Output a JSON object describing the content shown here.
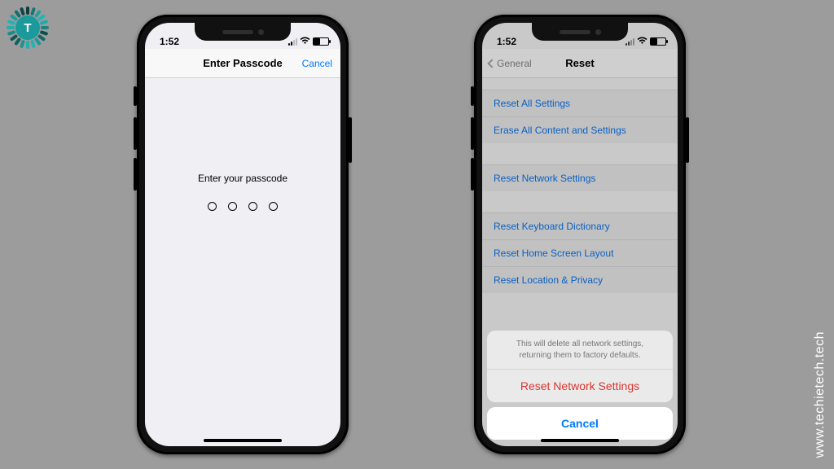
{
  "site": {
    "logo_letter": "T",
    "watermark": "www.techietech.tech"
  },
  "status": {
    "time": "1:52"
  },
  "phone1": {
    "nav_title": "Enter Passcode",
    "nav_right": "Cancel",
    "prompt": "Enter your passcode"
  },
  "phone2": {
    "nav_back": "General",
    "nav_title": "Reset",
    "groups": [
      [
        "Reset All Settings",
        "Erase All Content and Settings"
      ],
      [
        "Reset Network Settings"
      ],
      [
        "Reset Keyboard Dictionary",
        "Reset Home Screen Layout",
        "Reset Location & Privacy"
      ]
    ],
    "sheet": {
      "message": "This will delete all network settings, returning them to factory defaults.",
      "action": "Reset Network Settings",
      "cancel": "Cancel"
    }
  }
}
